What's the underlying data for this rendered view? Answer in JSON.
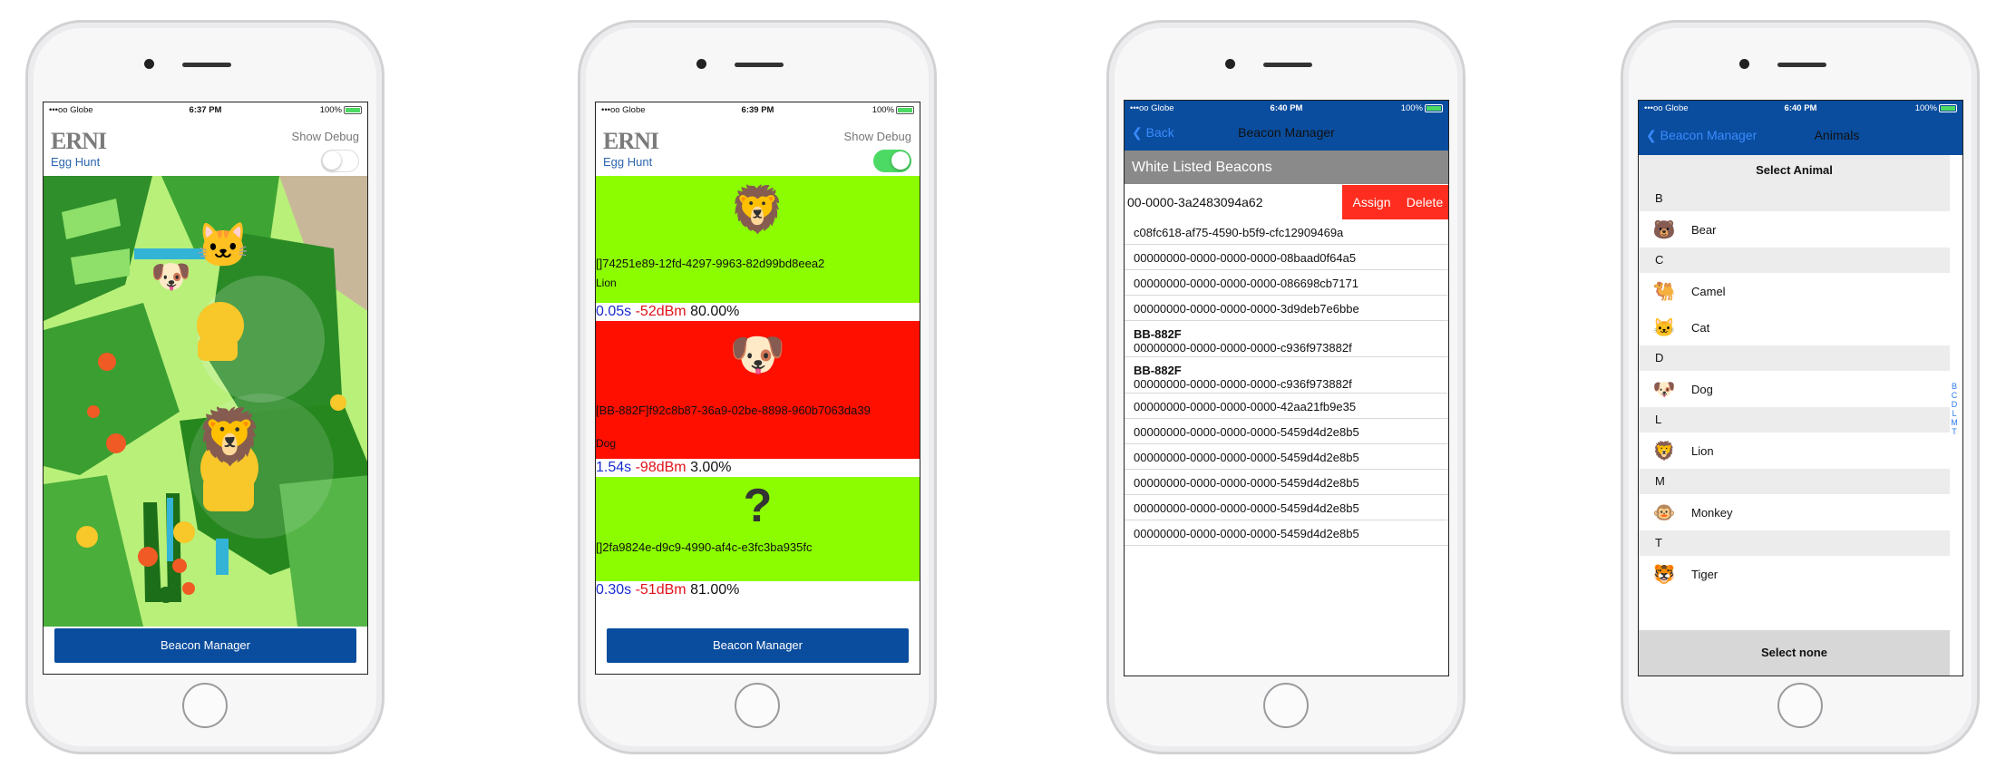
{
  "phones": [
    {
      "status": {
        "carrier": "•••oo Globe",
        "time": "6:37 PM",
        "battery": "100%"
      },
      "logo": "ERNI",
      "subtitle": "Egg Hunt",
      "debug_label": "Show Debug",
      "debug_on": false,
      "button": "Beacon Manager"
    },
    {
      "status": {
        "carrier": "•••oo Globe",
        "time": "6:39 PM",
        "battery": "100%"
      },
      "logo": "ERNI",
      "subtitle": "Egg Hunt",
      "debug_label": "Show Debug",
      "debug_on": true,
      "beacons": [
        {
          "uuid": "[]74251e89-12fd-4297-9963-82d99bd8eea2",
          "name": "Lion",
          "time": "0.05s",
          "rssi": "-52dBm",
          "pct": "80.00%",
          "bg": "#8cfd00"
        },
        {
          "uuid": "[BB-882F]f92c8b87-36a9-02be-8898-960b7063da39",
          "name": "Dog",
          "time": "1.54s",
          "rssi": "-98dBm",
          "pct": "3.00%",
          "bg": "#ff0f00"
        },
        {
          "uuid": "[]2fa9824e-d9c9-4990-af4c-e3fc3ba935fc",
          "name": "",
          "time": "0.30s",
          "rssi": "-51dBm",
          "pct": "81.00%",
          "bg": "#8cfd00"
        }
      ],
      "button": "Beacon Manager"
    },
    {
      "status": {
        "carrier": "•••oo Globe",
        "time": "6:40 PM",
        "battery": "100%"
      },
      "back": "Back",
      "title": "Beacon Manager",
      "section": "White Listed Beacons",
      "swipe_row": {
        "id": "00-0000-3a2483094a62",
        "assign": "Assign",
        "delete": "Delete"
      },
      "rows": [
        {
          "tag": "",
          "id": "c08fc618-af75-4590-b5f9-cfc12909469a"
        },
        {
          "tag": "",
          "id": "00000000-0000-0000-0000-08baad0f64a5"
        },
        {
          "tag": "",
          "id": "00000000-0000-0000-0000-086698cb7171"
        },
        {
          "tag": "",
          "id": "00000000-0000-0000-0000-3d9deb7e6bbe"
        },
        {
          "tag": "BB-882F",
          "id": "00000000-0000-0000-0000-c936f973882f"
        },
        {
          "tag": "BB-882F",
          "id": "00000000-0000-0000-0000-c936f973882f"
        },
        {
          "tag": "",
          "id": "00000000-0000-0000-0000-42aa21fb9e35"
        },
        {
          "tag": "",
          "id": "00000000-0000-0000-0000-5459d4d2e8b5"
        },
        {
          "tag": "",
          "id": "00000000-0000-0000-0000-5459d4d2e8b5"
        },
        {
          "tag": "",
          "id": "00000000-0000-0000-0000-5459d4d2e8b5"
        },
        {
          "tag": "",
          "id": "00000000-0000-0000-0000-5459d4d2e8b5"
        },
        {
          "tag": "",
          "id": "00000000-0000-0000-0000-5459d4d2e8b5"
        }
      ]
    },
    {
      "status": {
        "carrier": "•••oo Globe",
        "time": "6:40 PM",
        "battery": "100%"
      },
      "back": "Beacon Manager",
      "title": "Animals",
      "header": "Select Animal",
      "groups": [
        {
          "letter": "B",
          "items": [
            {
              "name": "Bear",
              "icon": "bear-icon",
              "glyph": "🐻"
            }
          ]
        },
        {
          "letter": "C",
          "items": [
            {
              "name": "Camel",
              "icon": "camel-icon",
              "glyph": "🐫"
            },
            {
              "name": "Cat",
              "icon": "cat-icon",
              "glyph": "🐱"
            }
          ]
        },
        {
          "letter": "D",
          "items": [
            {
              "name": "Dog",
              "icon": "dog-icon",
              "glyph": "🐶"
            }
          ]
        },
        {
          "letter": "L",
          "items": [
            {
              "name": "Lion",
              "icon": "lion-icon",
              "glyph": "🦁"
            }
          ]
        },
        {
          "letter": "M",
          "items": [
            {
              "name": "Monkey",
              "icon": "monkey-icon",
              "glyph": "🐵"
            }
          ]
        },
        {
          "letter": "T",
          "items": [
            {
              "name": "Tiger",
              "icon": "tiger-icon",
              "glyph": "🐯"
            }
          ]
        }
      ],
      "index": [
        "B",
        "C",
        "D",
        "L",
        "M",
        "T"
      ],
      "select_none": "Select none"
    }
  ]
}
